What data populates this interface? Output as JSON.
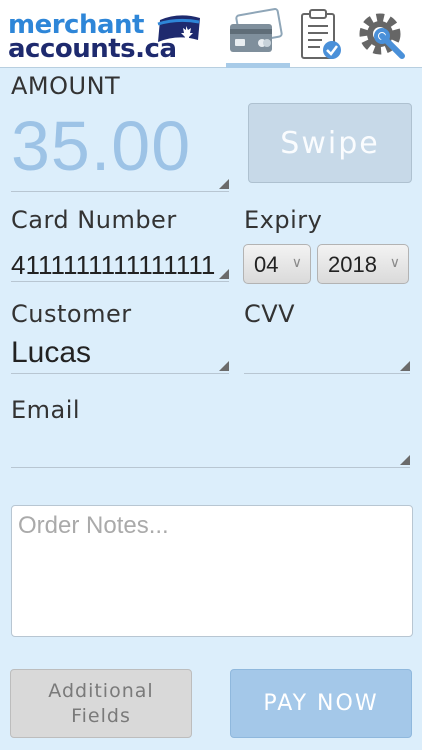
{
  "header": {
    "logo_line1": "merchant",
    "logo_line2": "accounts.ca",
    "nav": [
      {
        "icon": "credit-card-icon",
        "active": true
      },
      {
        "icon": "clipboard-check-icon",
        "active": false
      },
      {
        "icon": "gear-wrench-icon",
        "active": false
      }
    ]
  },
  "form": {
    "amount_label": "AMOUNT",
    "amount_value": "35.00",
    "swipe_label": "Swipe",
    "card_number_label": "Card Number",
    "card_number_value": "4111111111111111",
    "expiry_label": "Expiry",
    "expiry_month": "04",
    "expiry_year": "2018",
    "customer_label": "Customer",
    "customer_value": "Lucas",
    "cvv_label": "CVV",
    "cvv_value": "",
    "email_label": "Email",
    "email_value": "",
    "notes_placeholder": "Order Notes..."
  },
  "buttons": {
    "additional_fields_line1": "Additional",
    "additional_fields_line2": "Fields",
    "pay_now": "PAY NOW"
  },
  "colors": {
    "background": "#dceefb",
    "accent": "#a4c8e9",
    "amount_text": "#9dc3e6",
    "logo_blue": "#2e86d8",
    "logo_navy": "#1e2a6e"
  }
}
